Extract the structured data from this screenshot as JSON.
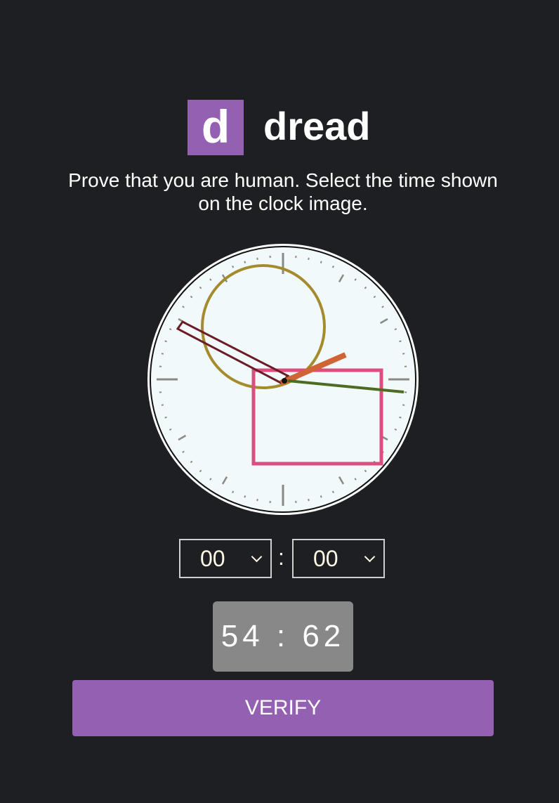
{
  "brand": {
    "logo_letter": "d",
    "name": "dread",
    "accent": "#9460b2"
  },
  "prompt": "Prove that you are human. Select the time shown on the clock image.",
  "time_picker": {
    "hour": "00",
    "separator": ":",
    "minute": "00"
  },
  "captcha_code": "54 : 62",
  "verify_label": "VERIFY"
}
